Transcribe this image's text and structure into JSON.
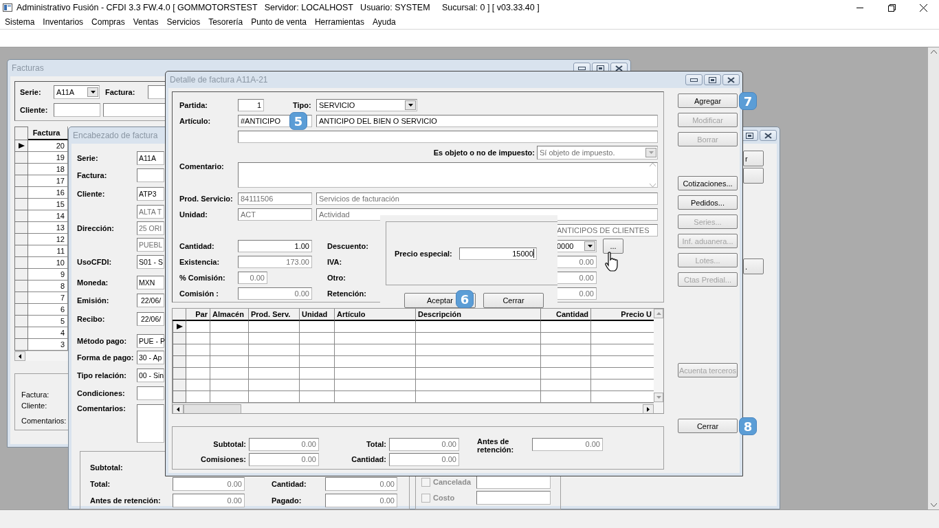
{
  "app": {
    "title": "Administrativo Fusión - CFDI 3.3 FW.4.0 [ GOMMOTORSTEST   Servidor: LOCALHOST   Usuario: SYSTEM     Sucursal: 0 ] [ v03.33.40 ]"
  },
  "menu": [
    "Sistema",
    "Inventarios",
    "Compras",
    "Ventas",
    "Servicios",
    "Tesorería",
    "Punto de venta",
    "Herramientas",
    "Ayuda"
  ],
  "facturas": {
    "title": "Facturas",
    "serie_label": "Serie:",
    "serie_value": "A11A",
    "factura_label": "Factura:",
    "cliente_label": "Cliente:",
    "column": "Factura",
    "rows": [
      {
        "value": "20",
        "selected": true
      },
      {
        "value": "19",
        "selected": false
      },
      {
        "value": "18",
        "selected": false
      },
      {
        "value": "17",
        "selected": false
      },
      {
        "value": "16",
        "selected": false
      },
      {
        "value": "15",
        "selected": false
      },
      {
        "value": "14",
        "selected": false
      },
      {
        "value": "13",
        "selected": false
      },
      {
        "value": "12",
        "selected": false
      },
      {
        "value": "11",
        "selected": false
      },
      {
        "value": "10",
        "selected": false
      },
      {
        "value": "9",
        "selected": false
      },
      {
        "value": "8",
        "selected": false
      },
      {
        "value": "7",
        "selected": false
      },
      {
        "value": "6",
        "selected": false
      },
      {
        "value": "5",
        "selected": false
      },
      {
        "value": "4",
        "selected": false
      },
      {
        "value": "3",
        "selected": false
      }
    ],
    "info_labels": [
      "Factura:",
      "Cliente:",
      "Comentarios:"
    ]
  },
  "encabezado": {
    "title": "Encabezado de factura",
    "fields": [
      {
        "label": "Serie:",
        "kind": "field",
        "value": "A11A",
        "disabled": false
      },
      {
        "label": "Factura:",
        "kind": "field"
      },
      {
        "label": "Cliente:",
        "kind": "field",
        "value": "ATP3",
        "disabled": false
      },
      {
        "kind": "field",
        "value": "ALTA T",
        "disabled": true
      },
      {
        "label": "Dirección:",
        "kind": "field",
        "value": "25 ORI",
        "disabled": true
      },
      {
        "kind": "field",
        "value": "PUEBL",
        "disabled": true
      },
      {
        "label": "UsoCFDI:",
        "kind": "field",
        "value": "S01 - S",
        "disabled": false
      },
      {
        "label": "Moneda:",
        "kind": "field",
        "value": "MXN",
        "disabled": false
      },
      {
        "label": "Emisión:",
        "kind": "date",
        "value": "22/06/",
        "disabled": false
      },
      {
        "label": "Recibo:",
        "kind": "date",
        "value": "22/06/",
        "disabled": false
      },
      {
        "label": "Método pago:",
        "kind": "field",
        "value": "PUE - P",
        "disabled": false
      },
      {
        "label": "Forma de pago:",
        "kind": "field",
        "value": "30 - Ap",
        "disabled": false
      },
      {
        "label": "Tipo relación:",
        "kind": "field",
        "value": "00 - Sin",
        "disabled": false
      },
      {
        "label": "Condiciones:",
        "kind": "field"
      },
      {
        "label": "Comentarios:",
        "kind": "memo"
      }
    ],
    "totals": [
      {
        "label": "Subtotal:"
      },
      {
        "label": "Total:",
        "value": "0.00"
      },
      {
        "label": "Antes de retención:",
        "value": "0.00"
      }
    ],
    "totals_right": [
      {
        "label": "Cantidad:",
        "value": "0.00"
      },
      {
        "label": "Pagado:",
        "value": "0.00"
      }
    ],
    "checks": [
      {
        "label": "Cancelada",
        "checked": false,
        "disabled": true
      },
      {
        "label": "Costo",
        "checked": false,
        "disabled": true
      }
    ],
    "side_buttons": [
      {
        "kind": "button",
        "label": "r"
      },
      {
        "kind": "blank"
      },
      {
        "kind": "button",
        "label": "."
      }
    ]
  },
  "detalle": {
    "title": "Detalle de factura A11A-21",
    "partida": {
      "label": "Partida:",
      "value": "1"
    },
    "tipo": {
      "label": "Tipo:",
      "value": "SERVICIO"
    },
    "articulo": {
      "label": "Artículo:",
      "code": "#ANTICIPO",
      "description": "ANTICIPO DEL BIEN O SERVICIO",
      "callout": "5"
    },
    "objeto_impuesto": {
      "label": "Es objeto o no de impuesto:",
      "value": "Sí objeto de impuesto.",
      "disabled": true
    },
    "comentario_label": "Comentario:",
    "prod_servicio": {
      "label": "Prod. Servicio:",
      "code": "84111506",
      "description": "Servicios de facturación"
    },
    "unidad": {
      "label": "Unidad:",
      "code": "ACT",
      "description": "Actividad"
    },
    "cuenta": "ANTICIPOS DE CLIENTES",
    "left_numbers": [
      {
        "label": "Cantidad:",
        "value": "1.00",
        "disabled": false
      },
      {
        "label": "Existencia:",
        "value": "173.00",
        "disabled": true
      },
      {
        "label": "% Comisión:",
        "value": "0.00",
        "disabled": true
      },
      {
        "label": "Comisión :",
        "value": "0.00",
        "disabled": true
      }
    ],
    "right_numbers": [
      {
        "label": "Descuento:",
        "kind": "select",
        "value": "0000",
        "button": "..."
      },
      {
        "label": "IVA:",
        "kind": "field",
        "value": "0.00"
      },
      {
        "label": "Otro:",
        "kind": "field",
        "value": "0.00"
      },
      {
        "label": "Retención:",
        "kind": "field",
        "value": "0.00"
      }
    ],
    "columns": [
      "Par",
      "Almacén",
      "Prod. Serv.",
      "Unidad",
      "Artículo",
      "Descripción",
      "Cantidad",
      "Precio U"
    ],
    "rows": [
      {
        "selected": true
      },
      {
        "selected": false
      },
      {
        "selected": false
      },
      {
        "selected": false
      },
      {
        "selected": false
      },
      {
        "selected": false
      },
      {
        "selected": false
      }
    ],
    "totals": [
      {
        "label": "Subtotal:",
        "value": "0.00"
      },
      {
        "label": "Total:",
        "value": "0.00"
      },
      {
        "label": "Antes de retención:",
        "value": "0.00"
      },
      {
        "label": "Comisiones:",
        "value": "0.00"
      },
      {
        "label": "Cantidad:",
        "value": "0.00"
      }
    ],
    "button_groups": [
      [
        {
          "label": "Agregar",
          "disabled": false,
          "callout": "7"
        },
        {
          "label": "Modificar",
          "disabled": true
        },
        {
          "label": "Borrar",
          "disabled": true
        }
      ],
      [
        {
          "label": "Cotizaciones...",
          "disabled": false
        },
        {
          "label": "Pedidos...",
          "disabled": false
        },
        {
          "label": "Series...",
          "disabled": true
        },
        {
          "label": "Inf. aduanera...",
          "disabled": true
        },
        {
          "label": "Lotes...",
          "disabled": true
        },
        {
          "label": "Ctas Predial...",
          "disabled": true
        }
      ],
      [
        {
          "label": "Acuenta terceros",
          "disabled": true
        }
      ],
      [
        {
          "label": "Cerrar",
          "disabled": false,
          "callout": "8"
        }
      ]
    ]
  },
  "precio_popup": {
    "label": "Precio especial:",
    "value": "15000",
    "buttons": [
      {
        "label": "Aceptar",
        "callout": "6"
      },
      {
        "label": "Cerrar"
      }
    ]
  }
}
